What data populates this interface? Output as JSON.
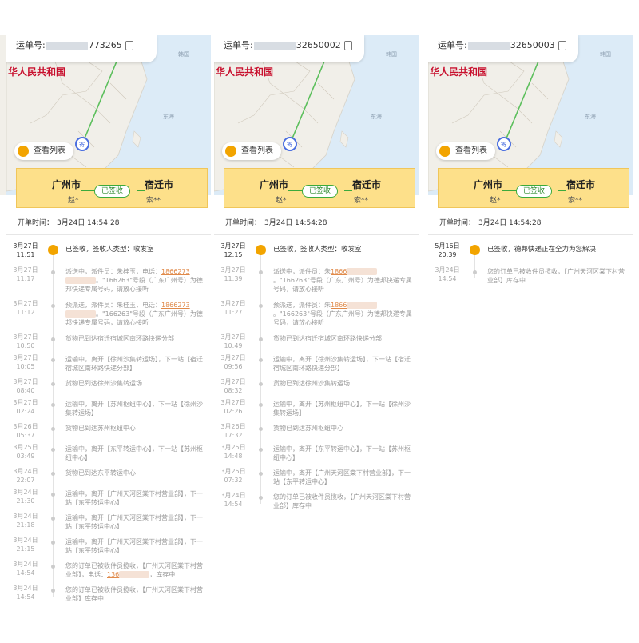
{
  "panels": [
    {
      "waybill_prefix": "运单号:",
      "waybill_tail": "773265",
      "country": "华人民共和国",
      "view_list": "查看列表",
      "from_city": "广州市",
      "to_city": "宿迁市",
      "sender": "赵*",
      "receiver": "索**",
      "status": "已签收",
      "open_time_label": "开单时间：",
      "open_time": "3月24日 14:54:28",
      "events": [
        {
          "d": "3月27日",
          "t": "11:51",
          "text": "已签收，签收人类型：收发室",
          "first": true,
          "h": 30
        },
        {
          "d": "3月27日",
          "t": "11:17",
          "text": "派送中，派件员：朱桂玉，电话：",
          "tel": "1866273",
          "text2": "。\"166263\"号段（广东广州号）为德邦快递专属号码，请放心接听",
          "h": 42
        },
        {
          "d": "3月27日",
          "t": "11:12",
          "text": "预派送，派件员：朱桂玉，电话：",
          "tel": "1866273",
          "text2": "。\"166263\"号段（广东广州号）为德邦快递专属号码，请放心接听",
          "h": 42
        },
        {
          "d": "3月27日",
          "t": "10:50",
          "text": "货物已到达宿迁宿城区南环路快递分部",
          "h": 26
        },
        {
          "d": "3月27日",
          "t": "10:05",
          "text": "运输中，离开【徐州沙集转运场】，下一站【宿迁宿城区南环路快递分部】",
          "h": 30
        },
        {
          "d": "3月27日",
          "t": "08:40",
          "text": "货物已到达徐州沙集转运场",
          "h": 26
        },
        {
          "d": "3月27日",
          "t": "02:24",
          "text": "运输中，离开【苏州枢纽中心】，下一站【徐州沙集转运场】",
          "h": 30
        },
        {
          "d": "3月26日",
          "t": "05:37",
          "text": "货物已到达苏州枢纽中心",
          "h": 26
        },
        {
          "d": "3月25日",
          "t": "03:49",
          "text": "运输中，离开【东平转运中心】，下一站【苏州枢纽中心】",
          "h": 30
        },
        {
          "d": "3月24日",
          "t": "22:07",
          "text": "货物已到达东平转运中心",
          "h": 26
        },
        {
          "d": "3月24日",
          "t": "21:30",
          "text": "运输中，离开【广州天河区棠下村营业部】，下一站【东平转运中心】",
          "h": 30
        },
        {
          "d": "3月24日",
          "t": "21:18",
          "text": "运输中，离开【广州天河区棠下村营业部】，下一站【东平转运中心】",
          "h": 30
        },
        {
          "d": "3月24日",
          "t": "21:15",
          "text": "运输中，离开【广州天河区棠下村营业部】，下一站【东平转运中心】",
          "h": 30
        },
        {
          "d": "3月24日",
          "t": "14:54",
          "text": "您的订单已被收件员揽收，【广州天河区棠下村营业部】，电话：",
          "tel": "136",
          "text2": "，库存中",
          "h": 30
        },
        {
          "d": "3月24日",
          "t": "14:54",
          "text": "您的订单已被收件员揽收，【广州天河区棠下村营业部】库存中",
          "h": 30
        }
      ]
    },
    {
      "waybill_prefix": "运单号:",
      "waybill_tail": "32650002",
      "country": "华人民共和国",
      "view_list": "查看列表",
      "from_city": "广州市",
      "to_city": "宿迁市",
      "sender": "赵*",
      "receiver": "索**",
      "status": "已签收",
      "open_time_label": "开单时间：",
      "open_time": "3月24日 14:54:28",
      "events": [
        {
          "d": "3月27日",
          "t": "12:15",
          "text": "已签收，签收人类型：收发室",
          "first": true,
          "h": 30
        },
        {
          "d": "3月27日",
          "t": "11:39",
          "text": "派送中，派件员：朱",
          "tel": "1866",
          "text2": "。\"166263\"号段（广东广州号）为德邦快递专属号码，请放心接听",
          "h": 42
        },
        {
          "d": "3月27日",
          "t": "11:27",
          "text": "预派送，派件员：朱",
          "tel": "1866",
          "text2": "。\"166263\"号段（广东广州号）为德邦快递专属号码，请放心接听",
          "h": 42
        },
        {
          "d": "3月27日",
          "t": "10:49",
          "text": "货物已到达宿迁宿城区南环路快递分部",
          "h": 26
        },
        {
          "d": "3月27日",
          "t": "09:56",
          "text": "运输中，离开【徐州沙集转运场】，下一站【宿迁宿城区南环路快递分部】",
          "h": 30
        },
        {
          "d": "3月27日",
          "t": "08:32",
          "text": "货物已到达徐州沙集转运场",
          "h": 26
        },
        {
          "d": "3月27日",
          "t": "02:26",
          "text": "运输中，离开【苏州枢纽中心】，下一站【徐州沙集转运场】",
          "h": 30
        },
        {
          "d": "3月26日",
          "t": "17:32",
          "text": "货物已到达苏州枢纽中心",
          "h": 26
        },
        {
          "d": "3月25日",
          "t": "14:48",
          "text": "运输中，离开【东平转运中心】，下一站【苏州枢纽中心】",
          "h": 30
        },
        {
          "d": "3月25日",
          "t": "07:32",
          "text": "运输中，离开【广州天河区棠下村营业部】，下一站【东平转运中心】",
          "h": 30
        },
        {
          "d": "3月24日",
          "t": "14:54",
          "text": "您的订单已被收件员揽收，【广州天河区棠下村营业部】库存中",
          "h": 30
        }
      ]
    },
    {
      "waybill_prefix": "运单号:",
      "waybill_tail": "32650003",
      "country": "华人民共和国",
      "view_list": "查看列表",
      "from_city": "广州市",
      "to_city": "宿迁市",
      "sender": "赵*",
      "receiver": "索**",
      "status": "已签收",
      "open_time_label": "开单时间：",
      "open_time": "3月24日 14:54:28",
      "events": [
        {
          "d": "5月16日",
          "t": "20:39",
          "text": "已签收，德邦快递正在全力为您解决",
          "first": true,
          "h": 30
        },
        {
          "d": "3月24日",
          "t": "14:54",
          "text": "您的订单已被收件员揽收，【广州天河区棠下村营业部】库存中",
          "h": 30
        }
      ]
    }
  ],
  "colors": {
    "accent": "#f2a400",
    "card": "#fde08a",
    "status": "#3caa3c",
    "tel": "#e08a4a",
    "map_sea": "#dcebf7",
    "map_land": "#f1efe9"
  }
}
